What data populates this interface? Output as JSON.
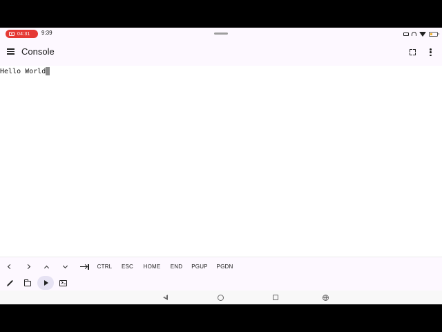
{
  "status_bar": {
    "recording_time": "04:31",
    "clock": "9:39"
  },
  "app_bar": {
    "title": "Console",
    "menu_icon": "menu-icon",
    "fullscreen_icon": "fullscreen-icon",
    "overflow_icon": "more-vert-icon"
  },
  "console": {
    "output": "Hello World"
  },
  "extra_keys": [
    {
      "name": "left-arrow-key",
      "icon": "chevron-left-icon",
      "label": ""
    },
    {
      "name": "right-arrow-key",
      "icon": "chevron-right-icon",
      "label": ""
    },
    {
      "name": "up-arrow-key",
      "icon": "chevron-up-icon",
      "label": ""
    },
    {
      "name": "down-arrow-key",
      "icon": "chevron-down-icon",
      "label": ""
    },
    {
      "name": "tab-key",
      "icon": "tab-icon",
      "label": ""
    },
    {
      "name": "ctrl-key",
      "label": "CTRL"
    },
    {
      "name": "esc-key",
      "label": "ESC"
    },
    {
      "name": "home-key",
      "label": "HOME"
    },
    {
      "name": "end-key",
      "label": "END"
    },
    {
      "name": "pgup-key",
      "label": "PGUP"
    },
    {
      "name": "pgdn-key",
      "label": "PGDN"
    }
  ],
  "bottom_toolbar": {
    "items": [
      "pencil-icon",
      "folder-icon",
      "play-icon",
      "terminal-icon"
    ],
    "active": "play-icon"
  },
  "colors": {
    "app_background": "#fdf8ff",
    "recording_pill": "#e53935",
    "active_tool": "#e6e2f3",
    "cursor": "#8a8a8a"
  }
}
